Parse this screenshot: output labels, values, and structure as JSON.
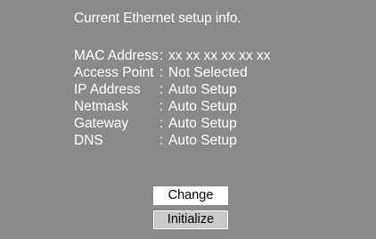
{
  "title": "Current Ethernet setup info.",
  "separator": ":",
  "info": [
    {
      "label": "MAC Address",
      "value": "xx xx xx xx xx xx"
    },
    {
      "label": "Access Point",
      "value": "Not Selected"
    },
    {
      "label": "IP Address",
      "value": "Auto Setup"
    },
    {
      "label": "Netmask",
      "value": "Auto Setup"
    },
    {
      "label": "Gateway",
      "value": "Auto Setup"
    },
    {
      "label": "DNS",
      "value": "Auto Setup"
    }
  ],
  "buttons": {
    "change_label": "Change",
    "initialize_label": "Initialize"
  },
  "colors": {
    "background": "#8a8a8a",
    "text": "#ffffff",
    "focused_button": "#ffffff",
    "button": "#c9c9c9"
  }
}
